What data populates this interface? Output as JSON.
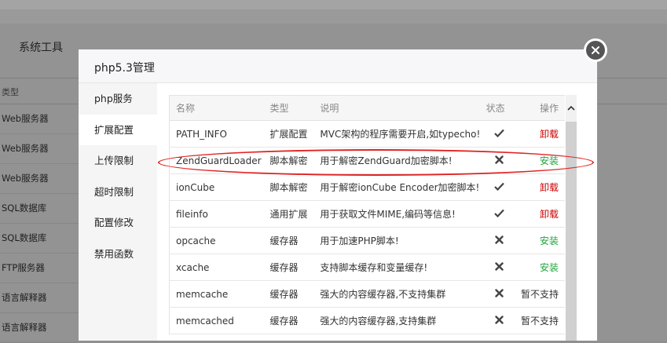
{
  "background": {
    "panel_title": "系统工具",
    "column_label": "类型",
    "rows": [
      "Web服务器",
      "Web服务器",
      "Web服务器",
      "SQL数据库",
      "SQL数据库",
      "FTP服务器",
      "语言解释器",
      "语言解释器"
    ]
  },
  "modal": {
    "title": "php5.3管理",
    "sidebar": [
      {
        "label": "php服务",
        "active": false
      },
      {
        "label": "扩展配置",
        "active": true
      },
      {
        "label": "上传限制",
        "active": false
      },
      {
        "label": "超时限制",
        "active": false
      },
      {
        "label": "配置修改",
        "active": false
      },
      {
        "label": "禁用函数",
        "active": false
      }
    ],
    "table": {
      "headers": {
        "name": "名称",
        "type": "类型",
        "desc": "说明",
        "status": "状态",
        "op": "操作"
      },
      "rows": [
        {
          "name": "PATH_INFO",
          "type": "扩展配置",
          "desc": "MVC架构的程序需要开启,如typecho!",
          "status": "check",
          "op": "卸载",
          "op_kind": "uninstall"
        },
        {
          "name": "ZendGuardLoader",
          "type": "脚本解密",
          "desc": "用于解密ZendGuard加密脚本!",
          "status": "cross",
          "op": "安装",
          "op_kind": "install"
        },
        {
          "name": "ionCube",
          "type": "脚本解密",
          "desc": "用于解密ionCube Encoder加密脚本!",
          "status": "check",
          "op": "卸载",
          "op_kind": "uninstall"
        },
        {
          "name": "fileinfo",
          "type": "通用扩展",
          "desc": "用于获取文件MIME,编码等信息!",
          "status": "check",
          "op": "卸载",
          "op_kind": "uninstall"
        },
        {
          "name": "opcache",
          "type": "缓存器",
          "desc": "用于加速PHP脚本!",
          "status": "cross",
          "op": "安装",
          "op_kind": "install"
        },
        {
          "name": "xcache",
          "type": "缓存器",
          "desc": "支持脚本缓存和变量缓存!",
          "status": "cross",
          "op": "安装",
          "op_kind": "install"
        },
        {
          "name": "memcache",
          "type": "缓存器",
          "desc": "强大的内容缓存器,不支持集群",
          "status": "cross",
          "op": "暂不支持",
          "op_kind": "na"
        },
        {
          "name": "memcached",
          "type": "缓存器",
          "desc": "强大的内容缓存器,支持集群",
          "status": "cross",
          "op": "暂不支持",
          "op_kind": "na"
        }
      ]
    }
  },
  "colors": {
    "uninstall": "#cc0000",
    "install": "#20a53a",
    "highlight": "#e02424"
  },
  "icons": {
    "close": "close-icon",
    "check": "check-icon",
    "cross": "cross-icon",
    "scroll_up": "chevron-up-icon"
  }
}
